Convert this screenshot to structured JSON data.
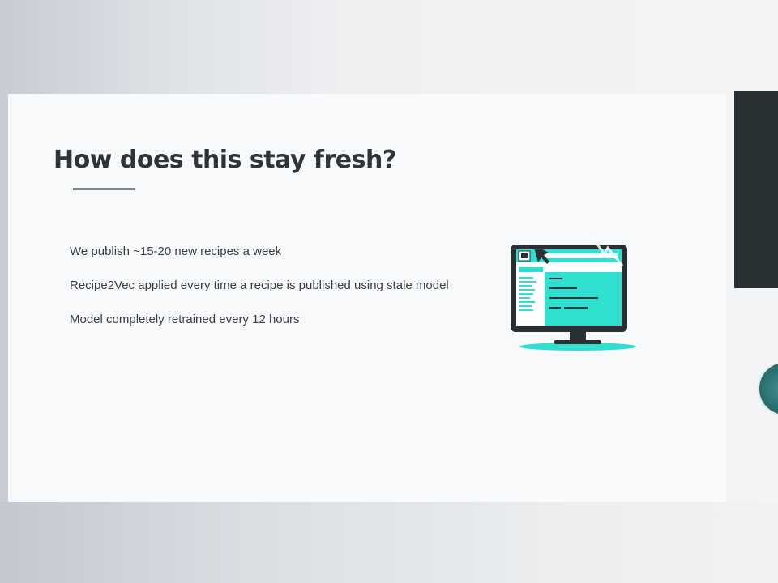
{
  "slide": {
    "title": "How does this stay fresh?",
    "bullets": [
      "We publish ~15-20 new recipes a week",
      "Recipe2Vec applied every time a recipe is published using stale model",
      "Model completely retrained every 12 hours"
    ]
  },
  "colors": {
    "accent": "#2fe0d0",
    "dark": "#283034",
    "title_text": "#2f3437",
    "body_text": "#3a3f42"
  }
}
